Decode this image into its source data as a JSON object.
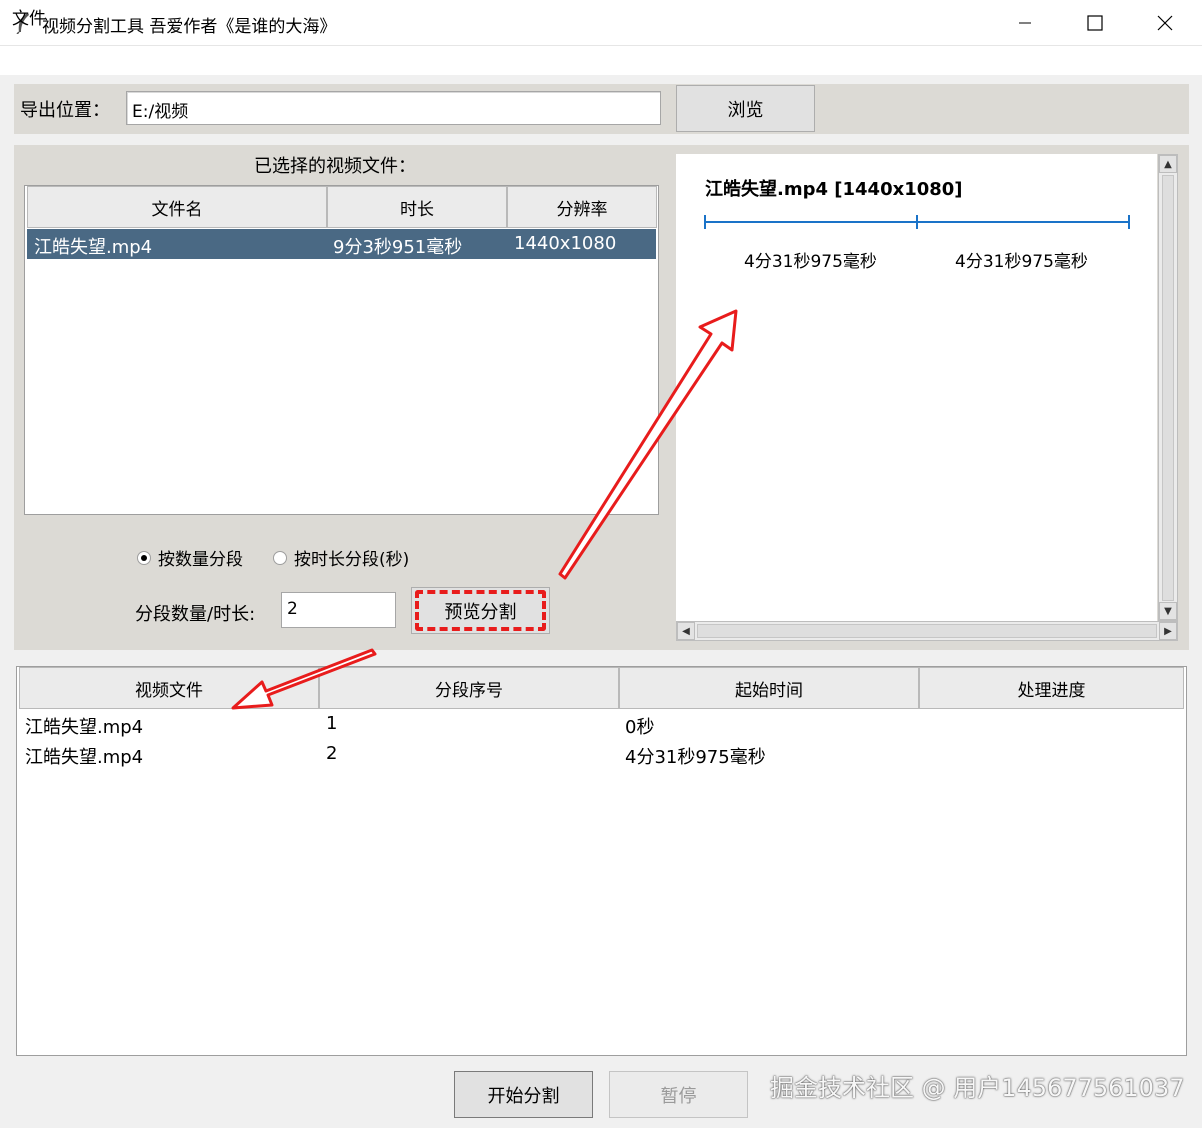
{
  "window": {
    "title": "视频分割工具 吾爱作者《是谁的大海》"
  },
  "menu": {
    "file": "文件"
  },
  "export": {
    "label": "导出位置：",
    "path": "E:/视频",
    "browse_label": "浏览"
  },
  "selected_files": {
    "heading": "已选择的视频文件：",
    "columns": [
      "文件名",
      "时长",
      "分辨率"
    ],
    "rows": [
      {
        "name": "江皓失望.mp4",
        "duration": "9分3秒951毫秒",
        "resolution": "1440x1080"
      }
    ]
  },
  "split_mode": {
    "option_count": "按数量分段",
    "option_duration": "按时长分段(秒)",
    "selected": "按数量分段"
  },
  "segment_input": {
    "label": "分段数量/时长:",
    "value": "2",
    "preview_button": "预览分割"
  },
  "preview": {
    "title": "江皓失望.mp4 [1440x1080]",
    "segments": [
      "4分31秒975毫秒",
      "4分31秒975毫秒"
    ]
  },
  "segments_table": {
    "columns": [
      "视频文件",
      "分段序号",
      "起始时间",
      "处理进度"
    ],
    "rows": [
      {
        "file": "江皓失望.mp4",
        "index": "1",
        "start": "0秒",
        "progress": ""
      },
      {
        "file": "江皓失望.mp4",
        "index": "2",
        "start": "4分31秒975毫秒",
        "progress": ""
      }
    ]
  },
  "actions": {
    "start": "开始分割",
    "pause": "暂停"
  },
  "watermark": "掘金技术社区 @ 用户145677561037",
  "colors": {
    "selection": "#4a6984",
    "annotation": "#e81c1c",
    "timeline": "#1a73c8",
    "panel_bg": "#dcdad5"
  }
}
